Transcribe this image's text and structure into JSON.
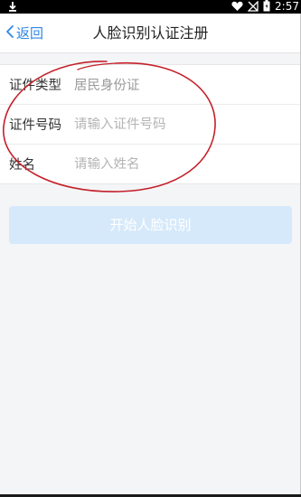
{
  "status_bar": {
    "time": "2:57",
    "icons": [
      "download-icon",
      "heart-icon",
      "signal-off-icon",
      "battery-icon"
    ]
  },
  "nav": {
    "back_label": "返回",
    "title": "人脸识别认证注册"
  },
  "form": {
    "id_type": {
      "label": "证件类型",
      "value": "居民身份证"
    },
    "id_number": {
      "label": "证件号码",
      "placeholder": "请输入证件号码"
    },
    "name": {
      "label": "姓名",
      "placeholder": "请输入姓名"
    }
  },
  "start_button": {
    "label": "开始人脸识别",
    "enabled": false
  },
  "colors": {
    "accent": "#2e88e6",
    "button_disabled": "#d6e9fb",
    "annotation": "#c4202a"
  }
}
